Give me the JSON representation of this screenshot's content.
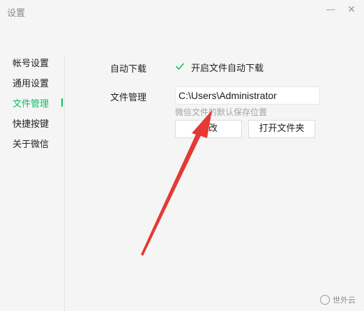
{
  "window": {
    "title": "设置",
    "minimize_glyph": "—",
    "close_glyph": "✕"
  },
  "sidebar": {
    "items": [
      {
        "label": "帐号设置",
        "active": false
      },
      {
        "label": "通用设置",
        "active": false
      },
      {
        "label": "文件管理",
        "active": true
      },
      {
        "label": "快捷按键",
        "active": false
      },
      {
        "label": "关于微信",
        "active": false
      }
    ]
  },
  "auto_download": {
    "label": "自动下载",
    "checkbox_label": "开启文件自动下载",
    "checked": true
  },
  "file_management": {
    "label": "文件管理",
    "path_value": "C:\\Users\\Administrator",
    "hint": "微信文件的默认保存位置",
    "change_button": "更改",
    "open_folder_button": "打开文件夹"
  },
  "colors": {
    "accent": "#07c160",
    "arrow": "#e53935"
  },
  "watermark": {
    "text": "世外云"
  }
}
